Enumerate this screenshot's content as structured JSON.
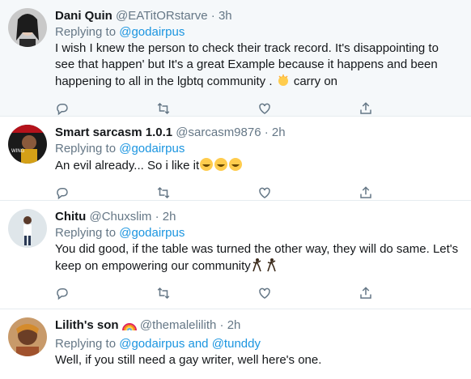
{
  "tweets": [
    {
      "name": "Dani Quin",
      "handle": "@EATitORstarve",
      "dot": "·",
      "time": "3h",
      "replying_label": "Replying to",
      "replying_to": "@godairpus",
      "text": "I wish I knew the person to check their track record. It's disappointing to see that happen' but It's a great Example because it happens and been happening to all in the lgbtq community .",
      "text_after_emoji": "carry on",
      "emoji": "clapping-hands-icon"
    },
    {
      "name": "Smart sarcasm 1.0.1",
      "handle": "@sarcasm9876",
      "dot": "·",
      "time": "2h",
      "replying_label": "Replying to",
      "replying_to": "@godairpus",
      "text": "An evil already... So i like it",
      "emoji": "grinning-face-icon"
    },
    {
      "name": "Chitu",
      "handle": "@Chuxslim",
      "dot": "·",
      "time": "2h",
      "replying_label": "Replying to",
      "replying_to": "@godairpus",
      "text_line1": "You did good, if the table was turned the other way, they will do same. Let's",
      "text_line2": "keep on empowering our community",
      "emoji": "dancing-man-icon"
    },
    {
      "name": "Lilith's son",
      "handle": "@themalelilith",
      "dot": "·",
      "time": "2h",
      "replying_label": "Replying to",
      "replying_to": "@godairpus",
      "and_label": "and",
      "replying_to_2": "@tunddy",
      "text": "Well, if you still need a gay writer, well here's one.",
      "emoji": "rainbow-icon"
    }
  ],
  "colors": {
    "link": "#1b95e0",
    "secondary": "#657786",
    "border": "#e6ecf0",
    "highlight_bg": "#f5f8fa"
  }
}
